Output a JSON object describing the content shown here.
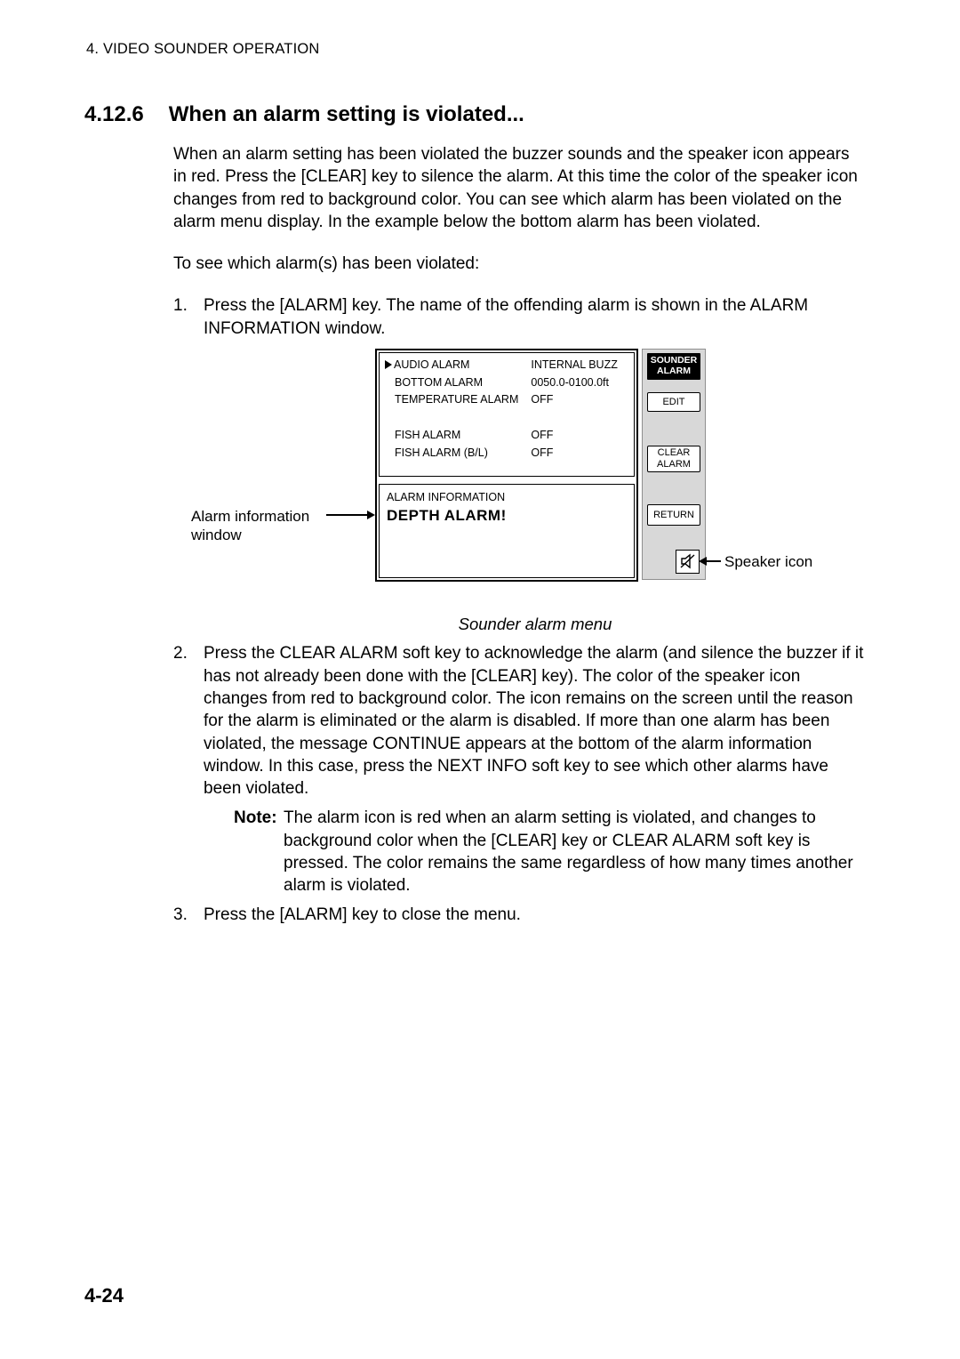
{
  "header": {
    "running": "4. VIDEO SOUNDER OPERATION"
  },
  "section": {
    "number": "4.12.6",
    "title": "When an alarm setting is violated...",
    "intro": "When an alarm setting has been violated the buzzer sounds and the speaker icon appears in red. Press the [CLEAR] key to silence the alarm. At this time the color of the speaker icon changes from red to background color. You can see which alarm has been violated on the alarm menu display. In the example below the bottom alarm has been violated.",
    "lead": "To see which alarm(s) has been violated:"
  },
  "steps": {
    "s1": "Press the [ALARM] key. The name of the offending alarm is shown in the ALARM INFORMATION window.",
    "s2": "Press the CLEAR ALARM soft key to acknowledge the alarm (and silence the buzzer if it has not already been done with the [CLEAR] key). The color of the speaker icon changes from red to background color. The icon remains on the screen until the reason for the alarm is eliminated or the alarm is disabled. If more than one alarm has been violated, the message CONTINUE appears at the bottom of the alarm information window. In this case, press the NEXT INFO soft key to see which other alarms have been violated.",
    "note_label": "Note:",
    "note": "The alarm icon is red when an alarm setting is violated, and changes to background color when the [CLEAR] key or CLEAR ALARM soft key is pressed. The color remains the same regardless of how many times another alarm is violated.",
    "s3": "Press the [ALARM] key to close the menu."
  },
  "figure": {
    "callout_left": "Alarm information\nwindow",
    "callout_right": "Speaker icon",
    "caption": "Sounder alarm menu",
    "menu": {
      "rows": [
        {
          "label": "AUDIO ALARM",
          "value": "INTERNAL BUZZ",
          "cursor": true
        },
        {
          "label": "BOTTOM ALARM",
          "value": "0050.0-0100.0ft"
        },
        {
          "label": "TEMPERATURE ALARM",
          "value": "OFF"
        },
        {
          "label": "",
          "value": ""
        },
        {
          "label": "FISH ALARM",
          "value": "OFF"
        },
        {
          "label": "FISH ALARM (B/L)",
          "value": "OFF"
        }
      ],
      "info_title": "ALARM INFORMATION",
      "info_alarm": "DEPTH ALARM!"
    },
    "soft": {
      "title_line1": "SOUNDER",
      "title_line2": "ALARM",
      "edit": "EDIT",
      "clear_line1": "CLEAR",
      "clear_line2": "ALARM",
      "return": "RETURN"
    }
  },
  "page_number": "4-24"
}
